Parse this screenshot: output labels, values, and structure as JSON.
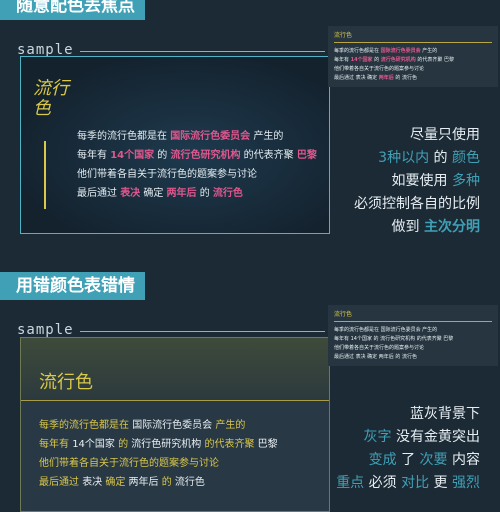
{
  "colors": {
    "teal": "#3fa0b6",
    "pink": "#e0578d",
    "yellow": "#d9c84a",
    "bg": "#1c2a35"
  },
  "section1": {
    "title": "随意配色丢焦点",
    "sample_label": "sample",
    "card_logo": "流行色",
    "para": [
      [
        {
          "t": "每季的流行色都是在 ",
          "c": "w"
        },
        {
          "t": "国际流行色委员会",
          "c": "p"
        },
        {
          "t": " 产生的",
          "c": "w"
        }
      ],
      [
        {
          "t": "每年有 ",
          "c": "w"
        },
        {
          "t": "14个国家",
          "c": "p"
        },
        {
          "t": " 的 ",
          "c": "w"
        },
        {
          "t": "流行色研究机构",
          "c": "p"
        },
        {
          "t": " 的代表齐聚 ",
          "c": "w"
        },
        {
          "t": "巴黎",
          "c": "p"
        }
      ],
      [
        {
          "t": "他们带着各自关于流行色的题案参与讨论",
          "c": "w"
        }
      ],
      [
        {
          "t": "最后通过 ",
          "c": "w"
        },
        {
          "t": "表决",
          "c": "p"
        },
        {
          "t": " 确定 ",
          "c": "w"
        },
        {
          "t": "两年后",
          "c": "p"
        },
        {
          "t": " 的 ",
          "c": "w"
        },
        {
          "t": "流行色",
          "c": "p"
        }
      ]
    ],
    "mini": {
      "title": "流行色",
      "lines": [
        [
          {
            "t": "每季的流行色都是在 ",
            "c": "w"
          },
          {
            "t": "国际流行色委员会",
            "c": "p"
          },
          {
            "t": " 产生的",
            "c": "w"
          }
        ],
        [
          {
            "t": "每年有 ",
            "c": "w"
          },
          {
            "t": "14个国家",
            "c": "p"
          },
          {
            "t": " 的 ",
            "c": "w"
          },
          {
            "t": "流行色研究机构",
            "c": "p"
          },
          {
            "t": " 的代表齐聚 巴黎",
            "c": "w"
          }
        ],
        [
          {
            "t": "他们带着各自关于流行色的题案参与讨论",
            "c": "w"
          }
        ],
        [
          {
            "t": "最后通过 表决 确定 ",
            "c": "w"
          },
          {
            "t": "两年后",
            "c": "p"
          },
          {
            "t": " 的 流行色",
            "c": "w"
          }
        ]
      ]
    },
    "right": [
      [
        {
          "t": "尽量只使用",
          "c": "w"
        }
      ],
      [
        {
          "t": "3种以内",
          "c": "t"
        },
        {
          "t": " 的 ",
          "c": "w"
        },
        {
          "t": "颜色",
          "c": "t"
        }
      ],
      [
        {
          "t": "如要使用 ",
          "c": "w"
        },
        {
          "t": "多种",
          "c": "t"
        }
      ],
      [
        {
          "t": "必须控制各自的比例",
          "c": "w"
        }
      ],
      [
        {
          "t": "做到 ",
          "c": "w"
        },
        {
          "t": "主次分明",
          "c": "tb"
        }
      ]
    ]
  },
  "section2": {
    "title": "用错颜色表错情",
    "sample_label": "sample",
    "card_heading": "流行色",
    "para": [
      [
        {
          "t": "每季的流行色都是在 ",
          "c": "y"
        },
        {
          "t": "国际流行色委员会",
          "c": "w"
        },
        {
          "t": " 产生的",
          "c": "y"
        }
      ],
      [
        {
          "t": "每年有 ",
          "c": "y"
        },
        {
          "t": "14个国家",
          "c": "w"
        },
        {
          "t": " 的 ",
          "c": "y"
        },
        {
          "t": "流行色研究机构",
          "c": "w"
        },
        {
          "t": " 的代表齐聚 ",
          "c": "y"
        },
        {
          "t": "巴黎",
          "c": "w"
        }
      ],
      [
        {
          "t": "他们带着各自关于流行色的题案参与讨论",
          "c": "y"
        }
      ],
      [
        {
          "t": "最后通过 ",
          "c": "y"
        },
        {
          "t": "表决",
          "c": "w"
        },
        {
          "t": " 确定 ",
          "c": "y"
        },
        {
          "t": "两年后",
          "c": "w"
        },
        {
          "t": " 的 ",
          "c": "y"
        },
        {
          "t": "流行色",
          "c": "w"
        }
      ]
    ],
    "mini": {
      "title": "流行色",
      "lines": [
        [
          {
            "t": "每季的流行色都是在 国际流行色委员会 产生的",
            "c": "w"
          }
        ],
        [
          {
            "t": "每年有 14个国家 的 流行色研究机构 的代表齐聚 巴黎",
            "c": "w"
          }
        ],
        [
          {
            "t": "他们带着各自关于流行色的题案参与讨论",
            "c": "w"
          }
        ],
        [
          {
            "t": "最后通过 表决 确定 两年后 的 流行色",
            "c": "w"
          }
        ]
      ]
    },
    "right": [
      [
        {
          "t": "蓝灰背景下",
          "c": "w"
        }
      ],
      [
        {
          "t": "灰字",
          "c": "t"
        },
        {
          "t": " 没有金黄突出",
          "c": "w"
        }
      ],
      [
        {
          "t": "变成",
          "c": "t"
        },
        {
          "t": " 了 ",
          "c": "w"
        },
        {
          "t": "次要",
          "c": "t"
        },
        {
          "t": " 内容",
          "c": "w"
        }
      ],
      [
        {
          "t": "重点",
          "c": "t"
        },
        {
          "t": " 必须 ",
          "c": "w"
        },
        {
          "t": "对比",
          "c": "t"
        },
        {
          "t": " 更 ",
          "c": "w"
        },
        {
          "t": "强烈",
          "c": "t"
        }
      ]
    ]
  }
}
